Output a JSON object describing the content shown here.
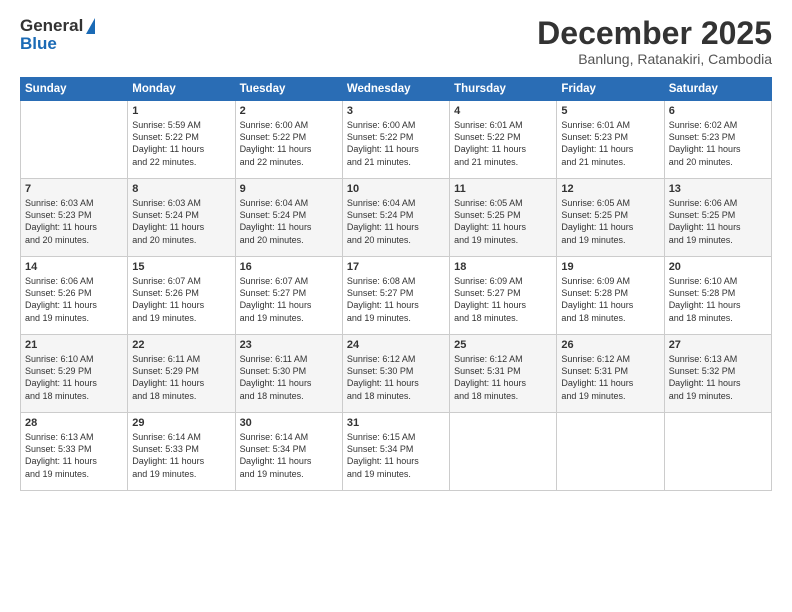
{
  "header": {
    "logo_general": "General",
    "logo_blue": "Blue",
    "month_title": "December 2025",
    "subtitle": "Banlung, Ratanakiri, Cambodia"
  },
  "days_of_week": [
    "Sunday",
    "Monday",
    "Tuesday",
    "Wednesday",
    "Thursday",
    "Friday",
    "Saturday"
  ],
  "weeks": [
    [
      {
        "day": "",
        "info": ""
      },
      {
        "day": "1",
        "info": "Sunrise: 5:59 AM\nSunset: 5:22 PM\nDaylight: 11 hours\nand 22 minutes."
      },
      {
        "day": "2",
        "info": "Sunrise: 6:00 AM\nSunset: 5:22 PM\nDaylight: 11 hours\nand 22 minutes."
      },
      {
        "day": "3",
        "info": "Sunrise: 6:00 AM\nSunset: 5:22 PM\nDaylight: 11 hours\nand 21 minutes."
      },
      {
        "day": "4",
        "info": "Sunrise: 6:01 AM\nSunset: 5:22 PM\nDaylight: 11 hours\nand 21 minutes."
      },
      {
        "day": "5",
        "info": "Sunrise: 6:01 AM\nSunset: 5:23 PM\nDaylight: 11 hours\nand 21 minutes."
      },
      {
        "day": "6",
        "info": "Sunrise: 6:02 AM\nSunset: 5:23 PM\nDaylight: 11 hours\nand 20 minutes."
      }
    ],
    [
      {
        "day": "7",
        "info": "Sunrise: 6:03 AM\nSunset: 5:23 PM\nDaylight: 11 hours\nand 20 minutes."
      },
      {
        "day": "8",
        "info": "Sunrise: 6:03 AM\nSunset: 5:24 PM\nDaylight: 11 hours\nand 20 minutes."
      },
      {
        "day": "9",
        "info": "Sunrise: 6:04 AM\nSunset: 5:24 PM\nDaylight: 11 hours\nand 20 minutes."
      },
      {
        "day": "10",
        "info": "Sunrise: 6:04 AM\nSunset: 5:24 PM\nDaylight: 11 hours\nand 20 minutes."
      },
      {
        "day": "11",
        "info": "Sunrise: 6:05 AM\nSunset: 5:25 PM\nDaylight: 11 hours\nand 19 minutes."
      },
      {
        "day": "12",
        "info": "Sunrise: 6:05 AM\nSunset: 5:25 PM\nDaylight: 11 hours\nand 19 minutes."
      },
      {
        "day": "13",
        "info": "Sunrise: 6:06 AM\nSunset: 5:25 PM\nDaylight: 11 hours\nand 19 minutes."
      }
    ],
    [
      {
        "day": "14",
        "info": "Sunrise: 6:06 AM\nSunset: 5:26 PM\nDaylight: 11 hours\nand 19 minutes."
      },
      {
        "day": "15",
        "info": "Sunrise: 6:07 AM\nSunset: 5:26 PM\nDaylight: 11 hours\nand 19 minutes."
      },
      {
        "day": "16",
        "info": "Sunrise: 6:07 AM\nSunset: 5:27 PM\nDaylight: 11 hours\nand 19 minutes."
      },
      {
        "day": "17",
        "info": "Sunrise: 6:08 AM\nSunset: 5:27 PM\nDaylight: 11 hours\nand 19 minutes."
      },
      {
        "day": "18",
        "info": "Sunrise: 6:09 AM\nSunset: 5:27 PM\nDaylight: 11 hours\nand 18 minutes."
      },
      {
        "day": "19",
        "info": "Sunrise: 6:09 AM\nSunset: 5:28 PM\nDaylight: 11 hours\nand 18 minutes."
      },
      {
        "day": "20",
        "info": "Sunrise: 6:10 AM\nSunset: 5:28 PM\nDaylight: 11 hours\nand 18 minutes."
      }
    ],
    [
      {
        "day": "21",
        "info": "Sunrise: 6:10 AM\nSunset: 5:29 PM\nDaylight: 11 hours\nand 18 minutes."
      },
      {
        "day": "22",
        "info": "Sunrise: 6:11 AM\nSunset: 5:29 PM\nDaylight: 11 hours\nand 18 minutes."
      },
      {
        "day": "23",
        "info": "Sunrise: 6:11 AM\nSunset: 5:30 PM\nDaylight: 11 hours\nand 18 minutes."
      },
      {
        "day": "24",
        "info": "Sunrise: 6:12 AM\nSunset: 5:30 PM\nDaylight: 11 hours\nand 18 minutes."
      },
      {
        "day": "25",
        "info": "Sunrise: 6:12 AM\nSunset: 5:31 PM\nDaylight: 11 hours\nand 18 minutes."
      },
      {
        "day": "26",
        "info": "Sunrise: 6:12 AM\nSunset: 5:31 PM\nDaylight: 11 hours\nand 19 minutes."
      },
      {
        "day": "27",
        "info": "Sunrise: 6:13 AM\nSunset: 5:32 PM\nDaylight: 11 hours\nand 19 minutes."
      }
    ],
    [
      {
        "day": "28",
        "info": "Sunrise: 6:13 AM\nSunset: 5:33 PM\nDaylight: 11 hours\nand 19 minutes."
      },
      {
        "day": "29",
        "info": "Sunrise: 6:14 AM\nSunset: 5:33 PM\nDaylight: 11 hours\nand 19 minutes."
      },
      {
        "day": "30",
        "info": "Sunrise: 6:14 AM\nSunset: 5:34 PM\nDaylight: 11 hours\nand 19 minutes."
      },
      {
        "day": "31",
        "info": "Sunrise: 6:15 AM\nSunset: 5:34 PM\nDaylight: 11 hours\nand 19 minutes."
      },
      {
        "day": "",
        "info": ""
      },
      {
        "day": "",
        "info": ""
      },
      {
        "day": "",
        "info": ""
      }
    ]
  ]
}
